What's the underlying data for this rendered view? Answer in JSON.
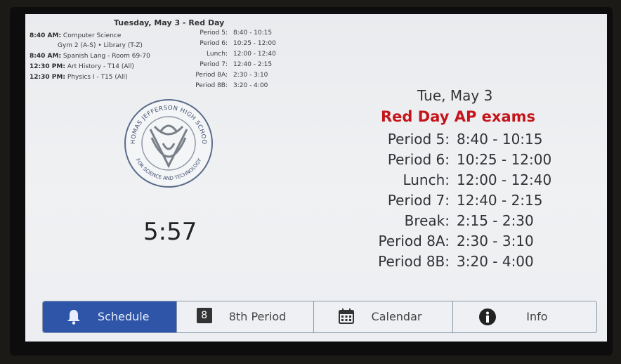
{
  "notice": {
    "title": "Tuesday, May 3 - Red Day",
    "events": [
      {
        "time": "8:40 AM:",
        "text": "Computer Science"
      },
      {
        "time": "",
        "text": "Gym 2 (A-S) • Library (T-Z)"
      },
      {
        "time": "8:40 AM:",
        "text": "Spanish Lang - Room 69-70"
      },
      {
        "time": "12:30 PM:",
        "text": "Art History - T14 (All)"
      },
      {
        "time": "12:30 PM:",
        "text": "Physics I - T15 (All)"
      }
    ],
    "schedule": [
      {
        "label": "Period 5:",
        "time": "8:40 - 10:15"
      },
      {
        "label": "Period 6:",
        "time": "10:25 - 12:00"
      },
      {
        "label": "Lunch:",
        "time": "12:00 - 12:40"
      },
      {
        "label": "Period 7:",
        "time": "12:40 - 2:15"
      },
      {
        "label": "Period 8A:",
        "time": "2:30 - 3:10"
      },
      {
        "label": "Period 8B:",
        "time": "3:20 - 4:00"
      }
    ]
  },
  "logo": {
    "top_text": "THOMAS JEFFERSON HIGH SCHOOL",
    "bottom_text": "FOR SCIENCE AND TECHNOLOGY"
  },
  "clock": "5:57",
  "main": {
    "date": "Tue, May 3",
    "headline": "Red Day AP exams",
    "schedule": [
      {
        "label": "Period 5:",
        "time": "8:40 - 10:15"
      },
      {
        "label": "Period 6:",
        "time": "10:25 - 12:00"
      },
      {
        "label": "Lunch:",
        "time": "12:00 - 12:40"
      },
      {
        "label": "Period 7:",
        "time": "12:40 - 2:15"
      },
      {
        "label": "Break:",
        "time": "2:15 - 2:30"
      },
      {
        "label": "Period 8A:",
        "time": "2:30 - 3:10"
      },
      {
        "label": "Period 8B:",
        "time": "3:20 - 4:00"
      }
    ]
  },
  "nav": {
    "schedule_label": "Schedule",
    "period8_badge": "8",
    "period8_label": "8th Period",
    "calendar_label": "Calendar",
    "info_label": "Info"
  },
  "colors": {
    "headline": "#c5151a",
    "nav_active": "#2f55a8",
    "bezel": "#0d0d0e"
  }
}
